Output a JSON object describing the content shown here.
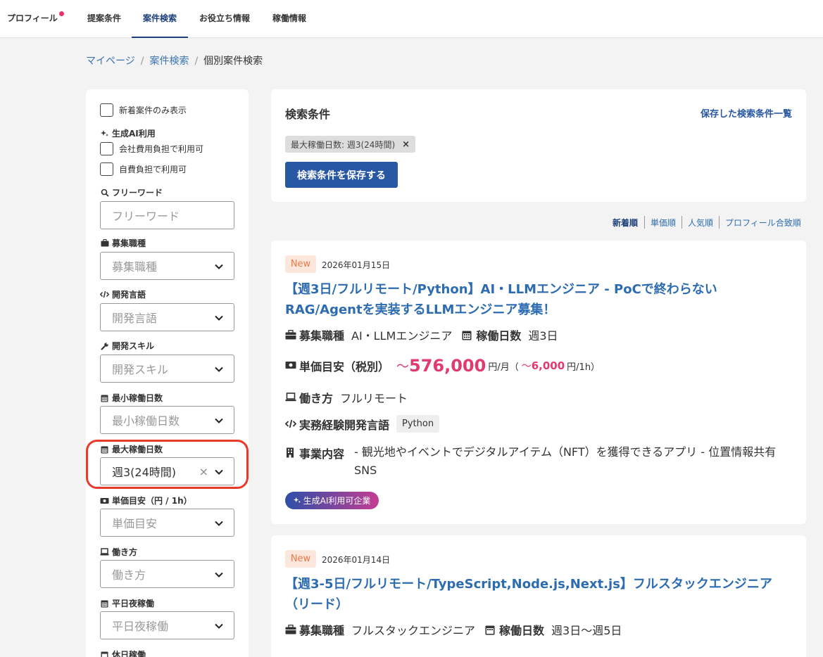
{
  "nav": {
    "profile": "プロフィール",
    "proposals": "提案条件",
    "search": "案件検索",
    "info": "お役立ち情報",
    "work": "稼働情報"
  },
  "breadcrumb": {
    "home": "マイページ",
    "search": "案件検索",
    "current": "個別案件検索",
    "separator": "/"
  },
  "sidebar": {
    "new_only": "新着案件のみ表示",
    "genai_label": "生成AI利用",
    "genai_company": "会社費用負担で利用可",
    "genai_self": "自費負担で利用可",
    "freeword_label": "フリーワード",
    "freeword_placeholder": "フリーワード",
    "job_type_label": "募集職種",
    "job_type_placeholder": "募集職種",
    "lang_label": "開発言語",
    "lang_placeholder": "開発言語",
    "skill_label": "開発スキル",
    "skill_placeholder": "開発スキル",
    "min_days_label": "最小稼働日数",
    "min_days_placeholder": "最小稼働日数",
    "max_days_label": "最大稼働日数",
    "max_days_value": "週3(24時間)",
    "rate_label": "単価目安（円 / 1h）",
    "rate_placeholder": "単価目安",
    "style_label": "働き方",
    "style_placeholder": "働き方",
    "night_label": "平日夜稼働",
    "night_placeholder": "平日夜稼働",
    "holiday_label": "休日稼働"
  },
  "conditions": {
    "title": "検索条件",
    "saved_link": "保存した検索条件一覧",
    "chip": "最大稼働日数: 週3(24時間)",
    "chip_close": "×",
    "save_button": "検索条件を保存する"
  },
  "sort": {
    "newest": "新着順",
    "price": "単価順",
    "popular": "人気順",
    "profile_match": "プロフィール合致順"
  },
  "labels": {
    "job_type": "募集職種",
    "work_days": "稼働日数",
    "rate": "単価目安（税別）",
    "style": "働き方",
    "lang": "実務経験開発言語",
    "business": "事業内容",
    "per_month": "円/月（",
    "per_hour": "円/1h）"
  },
  "jobs": [
    {
      "badge": "New",
      "date": "2026年01月15日",
      "title": "【週3日/フルリモート/Python】AI・LLMエンジニア - PoCで終わらないRAG/Agentを実装するLLMエンジニア募集！",
      "job_type": "AI・LLMエンジニア",
      "work_days": "週3日",
      "monthly_prefix": "～",
      "monthly": "576,000",
      "hourly_prefix": "～",
      "hourly": "6,000",
      "style": "フルリモート",
      "lang": "Python",
      "business": "- 観光地やイベントでデジタルアイテム（NFT）を獲得できるアプリ - 位置情報共有SNS",
      "ai_badge": "生成AI利用可企業"
    },
    {
      "badge": "New",
      "date": "2026年01月14日",
      "title": "【週3-5日/フルリモート/TypeScript,Node.js,Next.js】フルスタックエンジニア（リード）",
      "job_type": "フルスタックエンジニア",
      "work_days": "週3日～週5日"
    }
  ]
}
